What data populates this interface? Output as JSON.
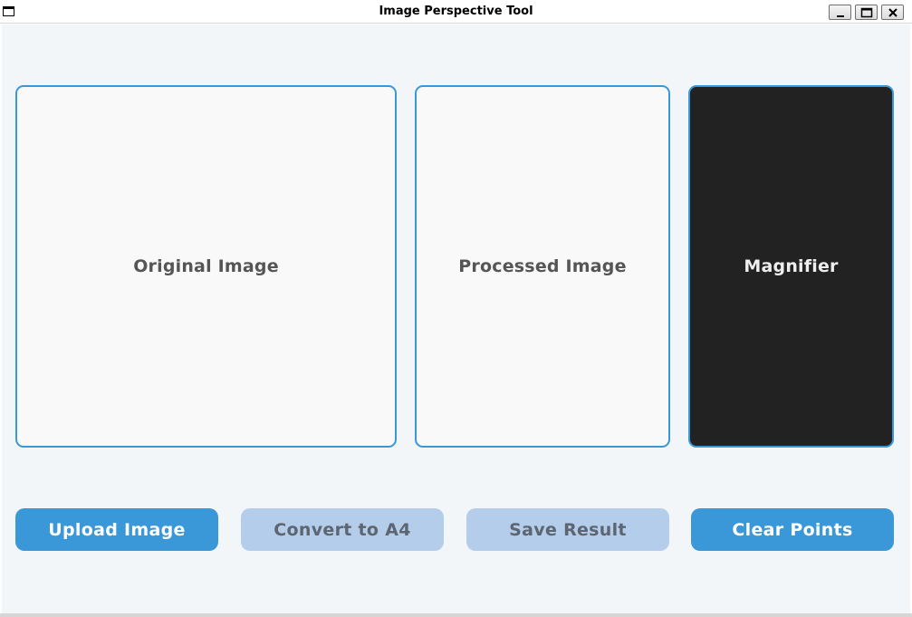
{
  "window": {
    "title": "Image Perspective Tool",
    "controls": {
      "minimize": "minimize-icon",
      "maximize": "maximize-icon",
      "close": "close-icon"
    }
  },
  "panels": {
    "original": {
      "label": "Original Image"
    },
    "processed": {
      "label": "Processed Image"
    },
    "magnifier": {
      "label": "Magnifier"
    }
  },
  "buttons": {
    "upload": {
      "label": "Upload Image",
      "enabled": true
    },
    "convert": {
      "label": "Convert to A4",
      "enabled": false
    },
    "save": {
      "label": "Save Result",
      "enabled": false
    },
    "clear": {
      "label": "Clear Points",
      "enabled": true
    }
  },
  "colors": {
    "accent": "#3a97d8",
    "disabled_button": "#b3cdea",
    "background": "#f3f6f9",
    "magnifier_background": "#222222"
  }
}
